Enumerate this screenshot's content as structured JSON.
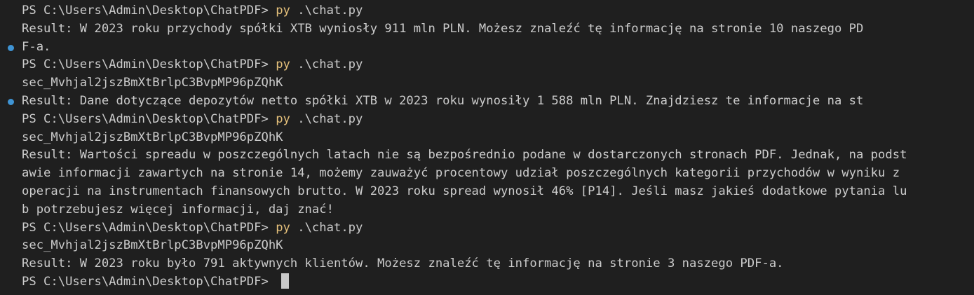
{
  "terminal": {
    "prompt": "PS C:\\Users\\Admin\\Desktop\\ChatPDF>",
    "command_name": "py",
    "command_args": " .\\chat.py",
    "colors": {
      "background": "#1f1f1f",
      "text": "#cccccc",
      "command": "#e5c07b",
      "marker": "#3f94d4"
    },
    "lines": [
      {
        "type": "prompt_cmd"
      },
      {
        "type": "text",
        "text": "Result: W 2023 roku przychody spółki XTB wyniosły 911 mln PLN. Możesz znaleźć tę informację na stronie 10 naszego PD"
      },
      {
        "type": "text",
        "marker": true,
        "text": "F-a."
      },
      {
        "type": "prompt_cmd"
      },
      {
        "type": "text",
        "text": "sec_Mvhjal2jszBmXtBrlpC3BvpMP96pZQhK"
      },
      {
        "type": "text",
        "marker": true,
        "text": "Result: Dane dotyczące depozytów netto spółki XTB w 2023 roku wynosiły 1 588 mln PLN. Znajdziesz te informacje na st"
      },
      {
        "type": "prompt_cmd"
      },
      {
        "type": "text",
        "text": "sec_Mvhjal2jszBmXtBrlpC3BvpMP96pZQhK"
      },
      {
        "type": "text",
        "text": "Result: Wartości spreadu w poszczególnych latach nie są bezpośrednio podane w dostarczonych stronach PDF. Jednak, na podst"
      },
      {
        "type": "text",
        "text": "awie informacji zawartych na stronie 14, możemy zauważyć procentowy udział poszczególnych kategorii przychodów w wyniku z"
      },
      {
        "type": "text",
        "text": "operacji na instrumentach finansowych brutto. W 2023 roku spread wynosił 46% [P14]. Jeśli masz jakieś dodatkowe pytania lu"
      },
      {
        "type": "text",
        "text": "b potrzebujesz więcej informacji, daj znać!"
      },
      {
        "type": "prompt_cmd"
      },
      {
        "type": "text",
        "text": "sec_Mvhjal2jszBmXtBrlpC3BvpMP96pZQhK"
      },
      {
        "type": "text",
        "text": "Result: W 2023 roku było 791 aktywnych klientów. Możesz znaleźć tę informację na stronie 3 naszego PDF-a."
      },
      {
        "type": "prompt_cursor"
      }
    ]
  }
}
